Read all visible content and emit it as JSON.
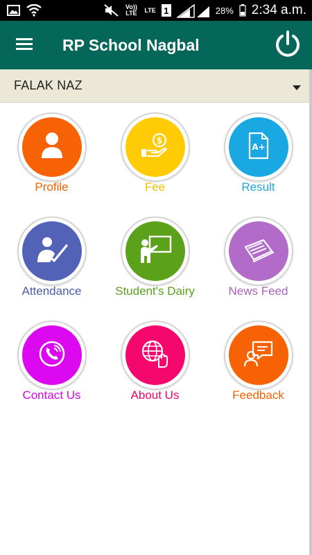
{
  "status_bar": {
    "battery": "28%",
    "time": "2:34 a.m.",
    "sim_label": "1",
    "volte": "Vo)) LTE",
    "lte": "LTE"
  },
  "app_bar": {
    "title": "RP School Nagbal"
  },
  "student_selector": {
    "selected": "FALAK NAZ"
  },
  "menu": [
    {
      "label": "Profile",
      "color": "#f76204",
      "label_color": "#ef6203",
      "icon": "person-icon"
    },
    {
      "label": "Fee",
      "color": "#ffcb05",
      "label_color": "#f2c200",
      "icon": "money-hand-icon"
    },
    {
      "label": "Result",
      "color": "#1aa8e3",
      "label_color": "#1ea6df",
      "icon": "result-document-icon"
    },
    {
      "label": "Attendance",
      "color": "#5262b7",
      "label_color": "#4d5aa8",
      "icon": "attendance-check-icon"
    },
    {
      "label": "Student's Dairy",
      "color": "#5ba21a",
      "label_color": "#5a9f1a",
      "icon": "teacher-board-icon"
    },
    {
      "label": "News Feed",
      "color": "#b26bc9",
      "label_color": "#a862bc",
      "icon": "newspaper-icon"
    },
    {
      "label": "Contact Us",
      "color": "#db08f0",
      "label_color": "#d10ae6",
      "icon": "phone-icon"
    },
    {
      "label": "About Us",
      "color": "#f5086e",
      "label_color": "#e80865",
      "icon": "globe-hand-icon"
    },
    {
      "label": "Feedback",
      "color": "#f76204",
      "label_color": "#ef6203",
      "icon": "feedback-icon"
    }
  ]
}
